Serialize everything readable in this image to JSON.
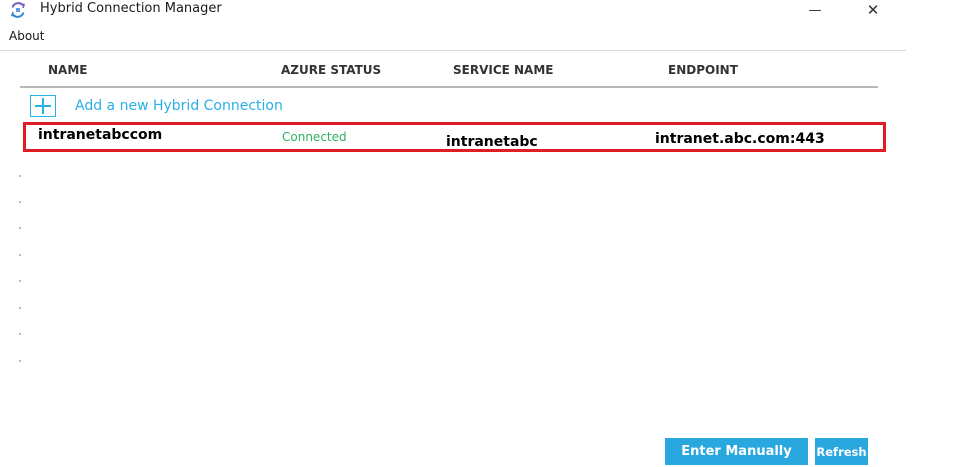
{
  "window": {
    "title": "Hybrid Connection Manager",
    "icon": "hybrid-connection-icon",
    "controls": {
      "minimize": "—",
      "close": "✕"
    }
  },
  "menu": {
    "items": [
      {
        "label": "About"
      }
    ]
  },
  "table": {
    "columns": [
      "NAME",
      "AZURE STATUS",
      "SERVICE NAME",
      "ENDPOINT"
    ],
    "add_action": {
      "icon": "plus-icon",
      "label": "Add a new Hybrid Connection"
    },
    "rows": [
      {
        "name": "intranetabccom",
        "status": "Connected",
        "service": "intranetabc",
        "endpoint": "intranet.abc.com:443"
      }
    ]
  },
  "buttons": {
    "enter_manually": "Enter Manually",
    "refresh": "Refresh"
  },
  "colors": {
    "accent": "#29a8e0",
    "connected": "#2fb064",
    "highlight": "#e01d24"
  }
}
